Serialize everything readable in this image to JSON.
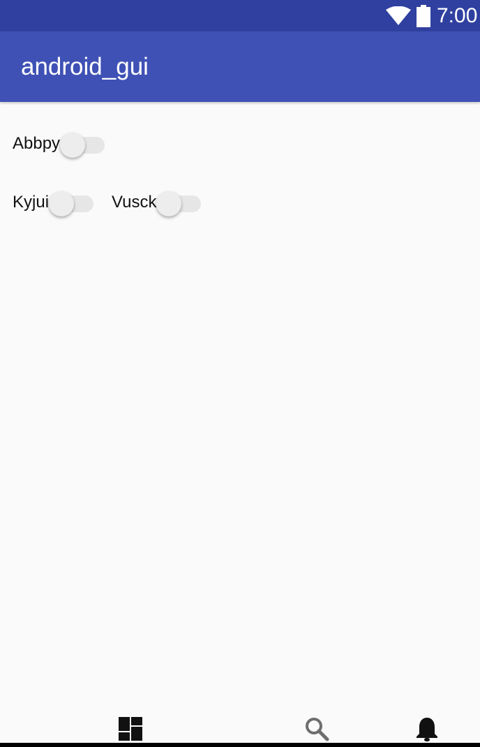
{
  "status_bar": {
    "time": "7:00",
    "icons": [
      "wifi-icon",
      "battery-icon"
    ]
  },
  "app_bar": {
    "title": "android_gui"
  },
  "switches": [
    {
      "label": "Abbpy",
      "checked": false
    },
    {
      "label": "Kyjui",
      "checked": false
    },
    {
      "label": "Vusck",
      "checked": false
    }
  ],
  "bottom_nav": {
    "items": [
      {
        "icon": "dashboard-icon"
      },
      {
        "icon": "search-icon"
      },
      {
        "icon": "notifications-icon"
      }
    ]
  },
  "colors": {
    "status_bar": "#3040a0",
    "app_bar": "#3f51b5",
    "background": "#fafafa",
    "switch_track": "#e6e6e6",
    "switch_thumb": "#ededed"
  }
}
